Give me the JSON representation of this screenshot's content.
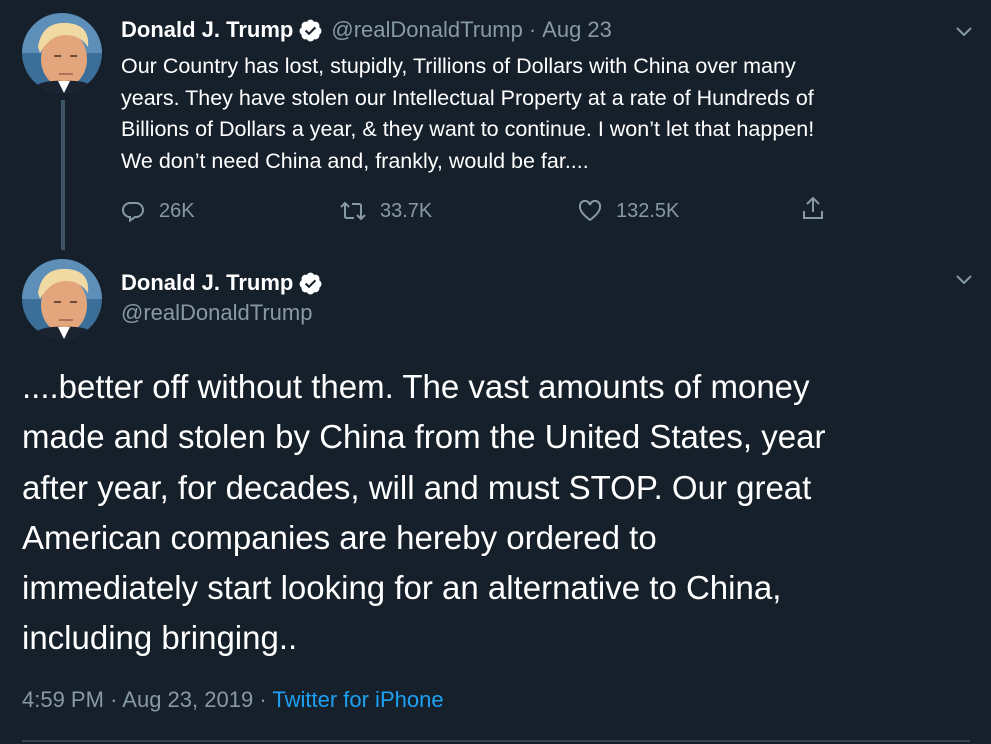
{
  "tweet1": {
    "name": "Donald J. Trump",
    "handle": "@realDonaldTrump",
    "separator": "·",
    "date": "Aug 23",
    "lines": [
      "Our Country has lost, stupidly, Trillions of Dollars with China over many",
      "years. They have stolen our Intellectual Property at a rate of Hundreds of",
      "Billions of Dollars a year, & they want to continue. I won’t let that happen!",
      "We don’t need China and, frankly, would be far...."
    ],
    "replies": "26K",
    "retweets": "33.7K",
    "likes": "132.5K"
  },
  "tweet2": {
    "name": "Donald J. Trump",
    "handle": "@realDonaldTrump",
    "lines": [
      "....better off without them. The vast amounts of money",
      "made and stolen by China from the United States, year",
      "after year, for decades, will and must STOP. Our great",
      "American companies are hereby ordered to",
      "immediately start looking for an alternative to China,",
      "including bringing.."
    ],
    "time": "4:59 PM",
    "separator": "·",
    "full_date": "Aug 23, 2019",
    "source": "Twitter for iPhone"
  },
  "icons": {
    "verified": "verified-badge-icon",
    "caret": "chevron-down-icon",
    "reply": "reply-icon",
    "retweet": "retweet-icon",
    "like": "heart-icon",
    "share": "share-icon"
  },
  "colors": {
    "background": "#15202b",
    "text": "#ffffff",
    "secondary": "#8899a6",
    "link": "#1da1f2",
    "thread_line": "#3d5466"
  }
}
